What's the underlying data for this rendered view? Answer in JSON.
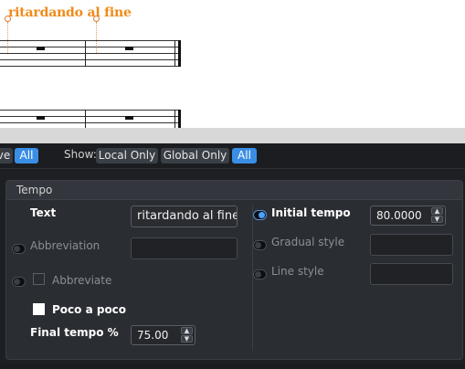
{
  "score": {
    "tempo_text": "ritardando al fine"
  },
  "filter_bar": {
    "partial_label": "ve",
    "all_left": "All",
    "show_label": "Show:",
    "local_only": "Local Only",
    "global_only": "Global Only",
    "all_right": "All"
  },
  "tempo_group": {
    "title": "Tempo",
    "text_label": "Text",
    "text_value": "ritardando al fine",
    "abbreviation_label": "Abbreviation",
    "abbreviate_label": "Abbreviate",
    "poco_a_poco_label": "Poco a poco",
    "final_tempo_label": "Final tempo %",
    "final_tempo_value": "75.00",
    "initial_tempo_label": "Initial tempo",
    "initial_tempo_value": "80.0000",
    "gradual_style_label": "Gradual style",
    "line_style_label": "Line style"
  },
  "colors": {
    "tempo_text": "#f08a18",
    "accent": "#3a8ee6",
    "panel_bg": "#1d1f22"
  }
}
